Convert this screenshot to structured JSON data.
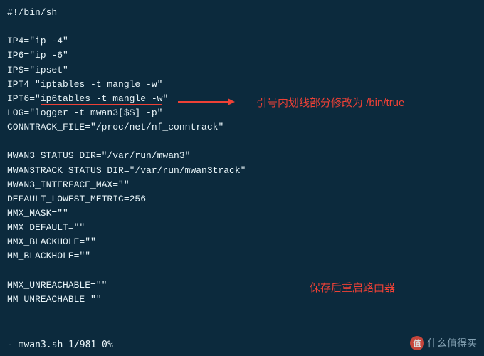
{
  "code": {
    "lines": [
      "#!/bin/sh",
      "",
      "IP4=\"ip -4\"",
      "IP6=\"ip -6\"",
      "IPS=\"ipset\"",
      "IPT4=\"iptables -t mangle -w\"",
      {
        "prefix": "IPT6=\"",
        "highlight": "ip6tables -t mangle -w",
        "suffix": "\""
      },
      "LOG=\"logger -t mwan3[$$] -p\"",
      "CONNTRACK_FILE=\"/proc/net/nf_conntrack\"",
      "",
      "MWAN3_STATUS_DIR=\"/var/run/mwan3\"",
      "MWAN3TRACK_STATUS_DIR=\"/var/run/mwan3track\"",
      "MWAN3_INTERFACE_MAX=\"\"",
      "DEFAULT_LOWEST_METRIC=256",
      "MMX_MASK=\"\"",
      "MMX_DEFAULT=\"\"",
      "MMX_BLACKHOLE=\"\"",
      "MM_BLACKHOLE=\"\"",
      "",
      "MMX_UNREACHABLE=\"\"",
      "MM_UNREACHABLE=\"\""
    ],
    "status": "- mwan3.sh 1/981 0%"
  },
  "annotations": {
    "line1": "引号内划线部分修改为 /bin/true",
    "line2": "保存后重启路由器"
  },
  "watermark": {
    "badge": "值",
    "text": "什么值得买"
  },
  "colors": {
    "background": "#0c2a3d",
    "text": "#e8f4f8",
    "highlight": "#ef4136"
  }
}
